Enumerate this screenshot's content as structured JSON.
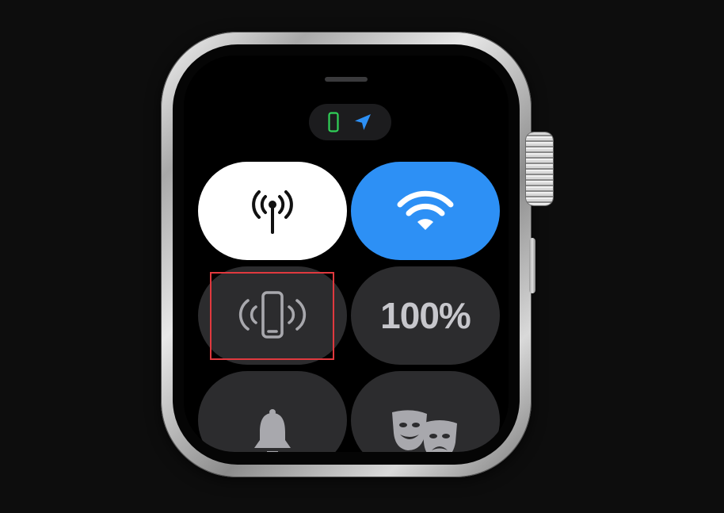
{
  "control_center": {
    "status": {
      "phone_icon": "phone-connected-icon",
      "location_icon": "location-arrow-icon",
      "phone_color": "#30d158",
      "location_color": "#2d90f5"
    },
    "tiles": [
      {
        "name": "cellular",
        "icon": "cellular-antenna-icon",
        "state": "on",
        "color": "#ffffff"
      },
      {
        "name": "wifi",
        "icon": "wifi-icon",
        "state": "on",
        "color": "#2d90f5"
      },
      {
        "name": "ping-iphone",
        "icon": "ping-phone-icon",
        "state": "off"
      },
      {
        "name": "battery",
        "label": "100%"
      },
      {
        "name": "silent-mode",
        "icon": "bell-icon",
        "state": "off"
      },
      {
        "name": "theater-mode",
        "icon": "theater-masks-icon",
        "state": "off"
      }
    ]
  },
  "highlight": {
    "target": "ping-iphone",
    "color": "#e0393e"
  }
}
